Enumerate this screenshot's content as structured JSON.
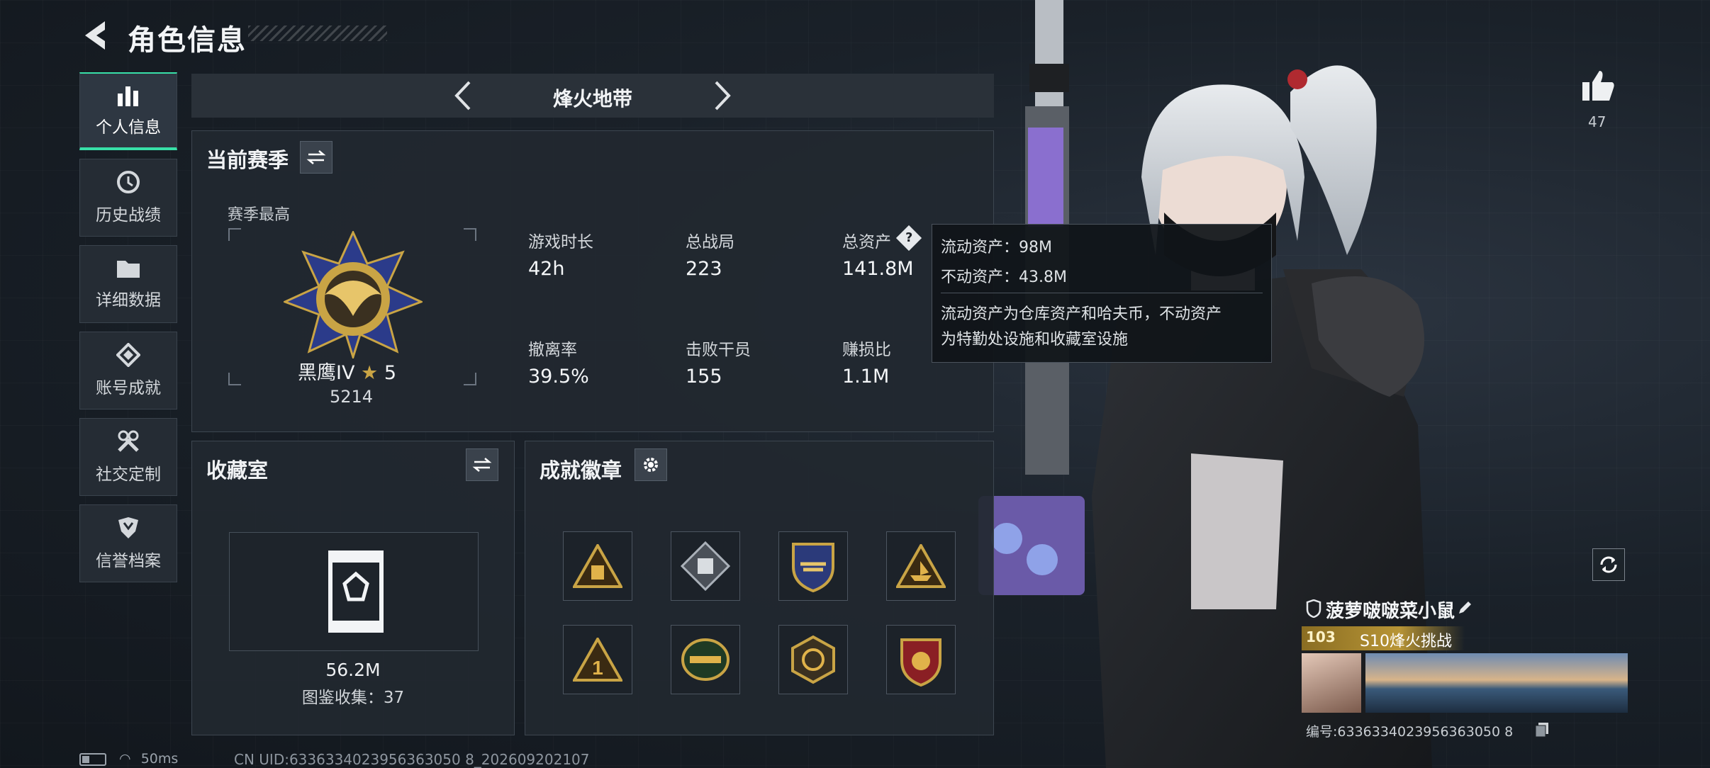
{
  "header": {
    "title": "角色信息"
  },
  "nav": [
    {
      "label": "个人信息",
      "icon": "bar-chart-icon",
      "active": true
    },
    {
      "label": "历史战绩",
      "icon": "clock-icon"
    },
    {
      "label": "详细数据",
      "icon": "folder-icon"
    },
    {
      "label": "账号成就",
      "icon": "achievement-icon"
    },
    {
      "label": "社交定制",
      "icon": "tools-icon"
    },
    {
      "label": "信誉档案",
      "icon": "shield-icon"
    }
  ],
  "mode": {
    "name": "烽火地带"
  },
  "season": {
    "title": "当前赛季",
    "best_label": "赛季最高",
    "rank_name": "黑鹰IV",
    "rank_stars": "5",
    "rank_points": "5214",
    "stats": [
      {
        "label": "游戏时长",
        "value": "42h"
      },
      {
        "label": "总战局",
        "value": "223"
      },
      {
        "label": "总资产",
        "value": "141.8M"
      },
      {
        "label": "撤离率",
        "value": "39.5%"
      },
      {
        "label": "击败干员",
        "value": "155"
      },
      {
        "label": "赚损比",
        "value": "1.1M"
      }
    ]
  },
  "tooltip": {
    "liquid": "流动资产：98M",
    "fixed": "不动资产：43.8M",
    "desc_line1": "流动资产为仓库资产和哈夫币，不动资产",
    "desc_line2": "为特勤处设施和收藏室设施"
  },
  "collection": {
    "title": "收藏室",
    "value": "56.2M",
    "count_text": "图鉴收集：37"
  },
  "achievements": {
    "title": "成就徽章",
    "badges": [
      "triangle-crate-badge",
      "diamond-box-badge",
      "shield-wings-badge",
      "triangle-ship-badge",
      "triangle-number-one-badge",
      "wreath-emblem-badge",
      "gold-hexagon-badge",
      "red-shield-badge"
    ]
  },
  "right": {
    "like_count": "47",
    "player_name": "菠萝啵啵菜小鼠",
    "level": "103",
    "tag": "S10烽火挑战",
    "id_text": "编号:6336334023956363050 8"
  },
  "status": {
    "ping": "50ms",
    "uid": "CN UID:6336334023956363050 8_202609202107"
  },
  "colors": {
    "accent": "#38e0a8",
    "gold": "#c9a445",
    "panel": "#222830"
  }
}
